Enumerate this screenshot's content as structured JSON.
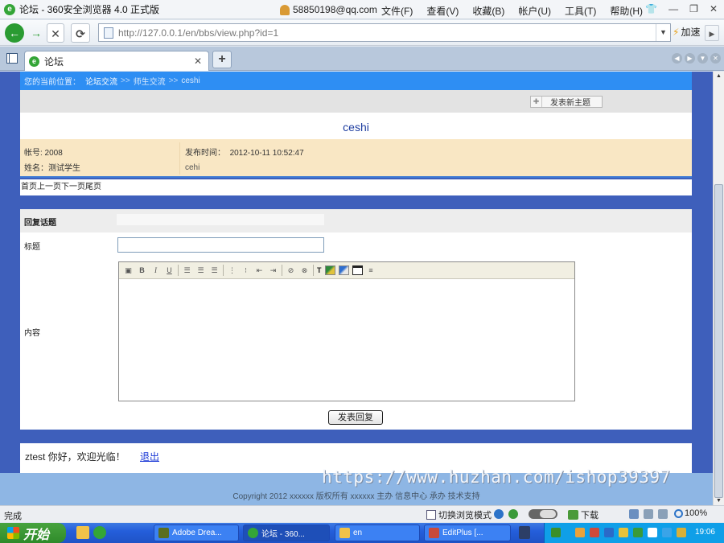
{
  "browser": {
    "title": "论坛 - 360安全浏览器 4.0 正式版",
    "account": "58850198@qq.com",
    "menu": [
      "文件(F)",
      "查看(V)",
      "收藏(B)",
      "帐户(U)",
      "工具(T)",
      "帮助(H)"
    ],
    "url": "http://127.0.0.1/en/bbs/view.php?id=1",
    "speedup_label": "加速",
    "tab_label": "论坛"
  },
  "page": {
    "breadcrumb": {
      "label": "您的当前位置：",
      "items": [
        "论坛交流",
        "师生交流",
        "ceshi"
      ],
      "separator": ">>"
    },
    "new_topic_label": "发表新主题",
    "post": {
      "title": "ceshi",
      "account": "帐号: 2008",
      "name": "姓名：测试学生",
      "time_label": "发布时间：",
      "time": "2012-10-11 10:52:47",
      "content": "cehi"
    },
    "pager": [
      "首页",
      "上一页",
      "下一页",
      "尾页"
    ],
    "reply": {
      "heading": "回复话题",
      "title_label": "标题",
      "title_value": "",
      "content_label": "内容",
      "submit_label": "发表回复"
    },
    "editor_toolbar": [
      "source-icon",
      "bold-icon",
      "italic-icon",
      "underline-icon",
      "align-left-icon",
      "align-center-icon",
      "align-right-icon",
      "ordered-list-icon",
      "unordered-list-icon",
      "outdent-icon",
      "indent-icon",
      "link-icon",
      "unlink-icon",
      "text-color-icon",
      "image-icon",
      "emoticon-icon",
      "table-icon",
      "horizontal-rule-icon"
    ],
    "editor_labels": {
      "bold": "B",
      "italic": "I",
      "underline": "U",
      "text_color": "T"
    },
    "welcome_text": "ztest 你好，欢迎光临！",
    "logout_label": "退出",
    "watermark": "https://www.huzhan.com/ishop39397",
    "copyright": "Copyright 2012 xxxxxx 版权所有  xxxxxx 主办  信息中心  承办  技术支持"
  },
  "statusbar": {
    "status": "完成",
    "mode_label": "切换浏览模式",
    "download_label": "下载",
    "zoom": "100%"
  },
  "taskbar": {
    "start_label": "开始",
    "tasks": [
      "Adobe Drea...",
      "论坛 - 360...",
      "en",
      "EditPlus [..."
    ],
    "clock": "19:06"
  },
  "colors": {
    "breadcrumb_bg": "#2e8ef3",
    "page_bg": "#3e5fbb",
    "post_info_bg": "#f9e7c4",
    "title_color": "#1f3ea0",
    "footer_bg": "#8eb6e4"
  }
}
